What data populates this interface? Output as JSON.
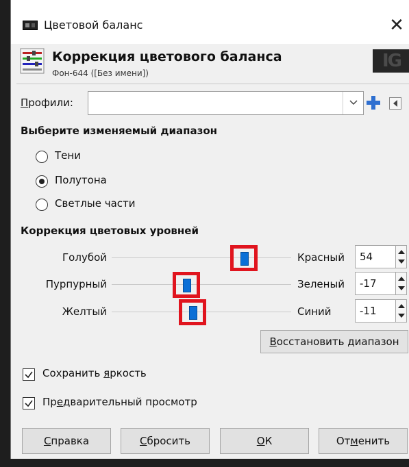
{
  "window": {
    "title": "Цветовой баланс",
    "close_glyph": "✕"
  },
  "header": {
    "title": "Коррекция цветового баланса",
    "subtitle": "Фон-644 ([Без имени])"
  },
  "profiles": {
    "label_u": "П",
    "label_rest": "рофили:",
    "value": ""
  },
  "range": {
    "title": "Выберите изменяемый диапазон",
    "options": [
      {
        "label": "Тени",
        "checked": false
      },
      {
        "label": "Полутона",
        "checked": true
      },
      {
        "label": "Светлые части",
        "checked": false
      }
    ]
  },
  "levels": {
    "title": "Коррекция цветовых уровней",
    "rows": [
      {
        "left": "Голубой",
        "right": "Красный",
        "value": "54"
      },
      {
        "left": "Пурпурный",
        "right": "Зеленый",
        "value": "-17"
      },
      {
        "left": "Желтый",
        "right": "Синий",
        "value": "-11"
      }
    ],
    "reset_u": "В",
    "reset_rest": "осстановить диапазон"
  },
  "options": {
    "preserve_pre": "Сохранить ",
    "preserve_u": "я",
    "preserve_rest": "ркость",
    "preview_pre": "Пр",
    "preview_u": "е",
    "preview_rest": "дварительный просмотр"
  },
  "buttons": {
    "help_u": "С",
    "help_rest": "правка",
    "reset_u": "С",
    "reset_rest": "бросить",
    "ok_u": "О",
    "ok_rest": "К",
    "cancel_pre": "От",
    "cancel_u": "м",
    "cancel_rest": "енить"
  },
  "colors": {
    "handle": "#0a6fd6",
    "highlight": "#e0141e",
    "plus_icon": "#2e6fd0"
  }
}
